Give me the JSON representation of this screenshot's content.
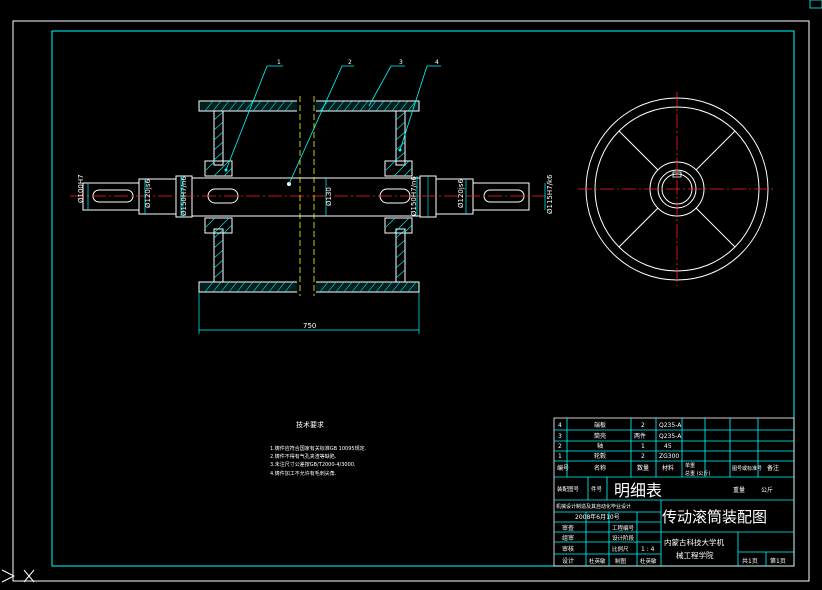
{
  "drawing": {
    "dimensions": {
      "d_left_end": "Ø100H7",
      "d_left_shoulder": "Ø120js6",
      "d_left_bearing": "Ø150H7/n6",
      "d_center": "Ø130",
      "d_right_bearing": "Ø150H7/n6",
      "d_right_shoulder": "Ø120js6",
      "d_right_end": "Ø115H7/k6",
      "overall_length": "750"
    },
    "balloons": [
      "1",
      "2",
      "3",
      "4"
    ]
  },
  "tech_requirements": {
    "title": "技术要求",
    "items": [
      "1.铸件应符合国家有关标准GB 10095规定.",
      "2.铸件不得有气孔夹渣等缺陷.",
      "3.未注尺寸公差按GB/T2000-4/3000.",
      "4.铸件加工不允许有毛刺尖角."
    ]
  },
  "parts_list": {
    "rows": [
      {
        "no": "4",
        "name": "端板",
        "qty": "2",
        "material": "Q235-A"
      },
      {
        "no": "3",
        "name": "筒壳",
        "qty": "两件",
        "material": "Q235-A"
      },
      {
        "no": "2",
        "name": "轴",
        "qty": "1",
        "material": "45"
      },
      {
        "no": "1",
        "name": "轮毂",
        "qty": "2",
        "material": "ZG300"
      }
    ],
    "headers": {
      "no": "编号",
      "name": "名称",
      "qty": "数量",
      "material": "材料",
      "unit_weight": "单重",
      "total_weight": "总重 (公斤)",
      "drawing_no": "图号或标准号",
      "remark": "备注"
    }
  },
  "title_block": {
    "ref_label": "装配图号",
    "part_no_label": "件号",
    "list_title": "明细表",
    "weight_label": "重量",
    "weight_unit": "公斤",
    "project": "机械设计制造及其自动化毕业设计",
    "date": "2008年6月10号",
    "drawing_title": "传动滚筒装配图",
    "rows_left": [
      "审查",
      "组审",
      "审核",
      "设计"
    ],
    "mid_labels": [
      "工程编号",
      "设计阶段",
      "比例尺",
      "1 : 4"
    ],
    "signer_cells": [
      "杜英敏",
      "制图",
      "杜英敏"
    ],
    "school_1": "内蒙古科技大学机",
    "school_2": "械工程学院",
    "sheets_total": "共1页",
    "sheet_no": "第1页"
  }
}
